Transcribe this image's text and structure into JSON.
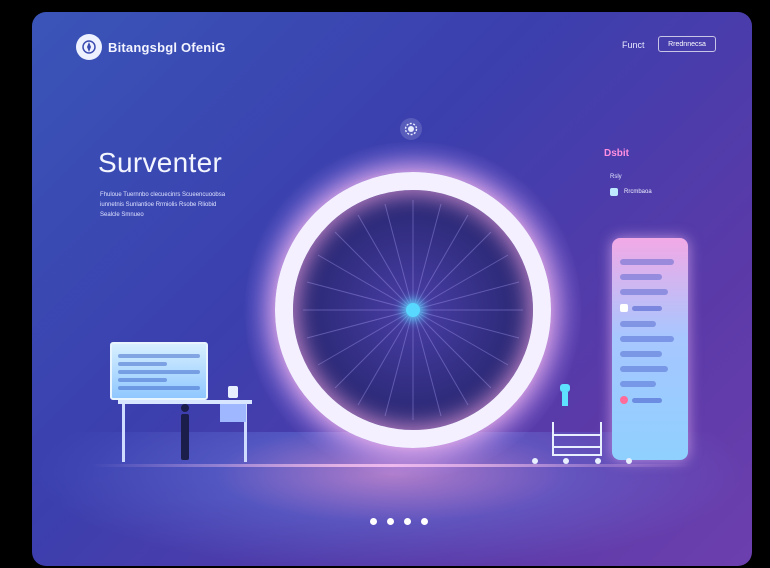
{
  "header": {
    "brand": "Bitangsbgl OfeniG",
    "nav_link": "Funct",
    "nav_button": "Rrednnecsa"
  },
  "hero": {
    "title": "Surventer",
    "body": "Fhuloue Tuernnbo clecuecinrs Scueencuoobsa iunnetnis Sunlantioe Rrmiolis Rsobe Rliobid Sealcle Smnueo"
  },
  "right_panel": {
    "title": "Dsbit",
    "small_text": "Rsly",
    "item_label": "Rrcmbaoa"
  },
  "carousel": {
    "dots": [
      "1",
      "2",
      "3",
      "4"
    ]
  },
  "colors": {
    "accent_pink": "#ff8fe0",
    "ring": "#f5f0ff",
    "hub": "#58d8ff",
    "background_start": "#3a55b8",
    "background_end": "#6d3fae"
  },
  "icons": {
    "logo": "compass-logo-icon",
    "top_icon": "gear-icon"
  }
}
